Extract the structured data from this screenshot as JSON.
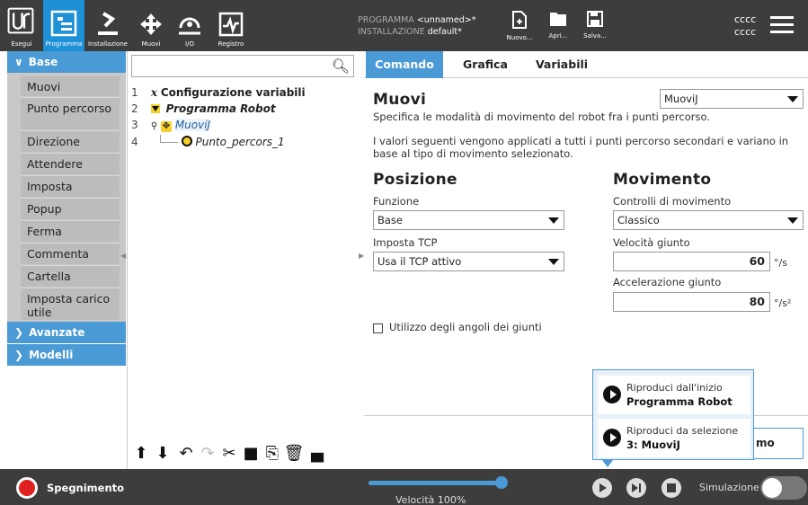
{
  "header": {
    "nav": [
      {
        "id": "run",
        "label": "Esegui",
        "icon": "ur-logo-icon"
      },
      {
        "id": "program",
        "label": "Programma",
        "icon": "program-icon"
      },
      {
        "id": "installation",
        "label": "Installazione",
        "icon": "installation-icon"
      },
      {
        "id": "move",
        "label": "Muovi",
        "icon": "move-icon"
      },
      {
        "id": "io",
        "label": "I/O",
        "icon": "io-icon"
      },
      {
        "id": "log",
        "label": "Registro",
        "icon": "log-icon"
      }
    ],
    "program_label": "PROGRAMMA",
    "program_value": "<unnamed>*",
    "installation_label": "INSTALLAZIONE",
    "installation_value": "default*",
    "file_buttons": [
      {
        "label": "Nuovo...",
        "icon": "new-file-icon"
      },
      {
        "label": "Apri...",
        "icon": "folder-icon"
      },
      {
        "label": "Salva...",
        "icon": "save-icon"
      }
    ],
    "user_line1": "cccc",
    "user_line2": "cccc",
    "active_color": "#1e90d6"
  },
  "sidebar": {
    "base_label": "Base",
    "commands": [
      "Muovi",
      "Punto percorso",
      "Direzione",
      "Attendere",
      "Imposta",
      "Popup",
      "Ferma",
      "Commenta",
      "Cartella",
      "Imposta carico utile"
    ],
    "advanced_label": "Avanzate",
    "templates_label": "Modelli"
  },
  "tree": {
    "search_placeholder": "",
    "rows": [
      {
        "num": "1",
        "text": "Configurazione variabili"
      },
      {
        "num": "2",
        "text": "Programma Robot"
      },
      {
        "num": "3",
        "text": "MuoviJ"
      },
      {
        "num": "4",
        "text": "Punto_percors_1"
      }
    ]
  },
  "tabs": [
    "Comando",
    "Grafica",
    "Variabili"
  ],
  "move": {
    "title": "Muovi",
    "type_selected": "MuoviJ",
    "desc": "Specifica le modalità di movimento del robot fra i punti percorso.",
    "info": "I valori seguenti vengono applicati a tutti i punti percorso secondari e variano in base al tipo di movimento selezionato.",
    "position_title": "Posizione",
    "feature_label": "Funzione",
    "feature_value": "Base",
    "tcp_label": "Imposta TCP",
    "tcp_value": "Usa il TCP attivo",
    "motion_title": "Movimento",
    "motion_ctrl_label": "Controlli di movimento",
    "motion_ctrl_value": "Classico",
    "joint_speed_label": "Velocità giunto",
    "joint_speed_value": "60",
    "joint_speed_unit": "°/s",
    "joint_accel_label": "Accelerazione giunto",
    "joint_accel_value": "80",
    "joint_accel_unit": "°/s²",
    "joint_angles_label": "Utilizzo degli angoli dei giunti"
  },
  "popup": {
    "item1_line1": "Riproduci dall'inizio",
    "item1_line2": "Programma Robot",
    "item2_line1": "Riproduci da selezione",
    "item2_line2": "3: MuoviJ",
    "ghost_text": "mo"
  },
  "footer": {
    "power_label": "Spegnimento",
    "speed_label": "Velocità 100%",
    "speed_fraction": 1.0,
    "sim_label": "Simulazione"
  }
}
